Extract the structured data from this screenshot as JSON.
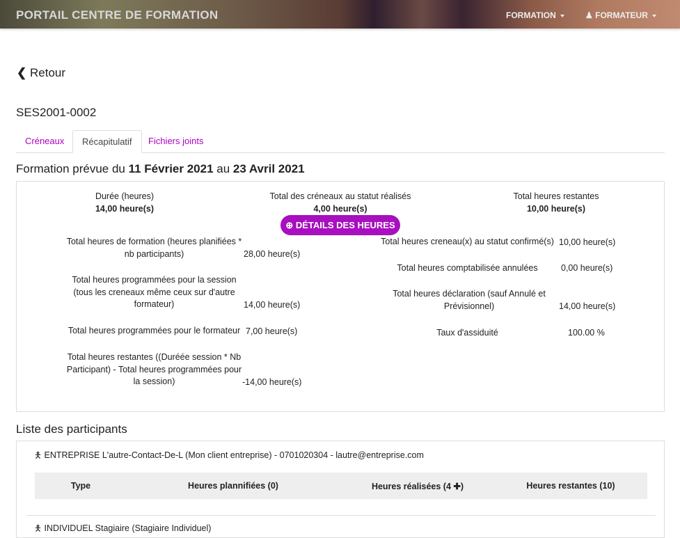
{
  "nav": {
    "brand": "PORTAIL CENTRE DE FORMATION",
    "formation": "FORMATION",
    "formateur": "FORMATEUR"
  },
  "back": "Retour",
  "session_id": "SES2001-0002",
  "tabs": [
    "Créneaux",
    "Récapitulatif",
    "Fichiers joints"
  ],
  "heading": {
    "prefix": "Formation prévue du ",
    "start": "11 Février 2021",
    "mid": " au ",
    "end": "23 Avril 2021"
  },
  "summary": [
    {
      "label": "Durée (heures)",
      "value": "14,00 heure(s)"
    },
    {
      "label": "Total des créneaux au statut réalisés",
      "value": "4,00 heure(s)"
    },
    {
      "label": "Total heures restantes",
      "value": "10,00 heure(s)"
    }
  ],
  "details_button": "DÉTAILS DES HEURES",
  "left_details": [
    {
      "label": "Total heures de formation (heures planifiées * nb participants)",
      "value": "28,00 heure(s)"
    },
    {
      "label": "Total heures programmées pour la session (tous les creneaux même ceux sur d'autre formateur)",
      "value": "14,00 heure(s)"
    },
    {
      "label": "Total heures programmées pour le formateur",
      "value": "7,00 heure(s)"
    },
    {
      "label": "Total heures restantes ((Duréée session * Nb Participant) - Total heures programmées pour la session)",
      "value": "-14,00 heure(s)"
    }
  ],
  "right_details": [
    {
      "label": "Total heures creneau(x) au statut confirmé(s)",
      "value": "10,00 heure(s)"
    },
    {
      "label": "Total heures comptabilisée annulées",
      "value": "0,00 heure(s)"
    },
    {
      "label": "Total heures déclaration (sauf Annulé et Prévisionnel)",
      "value": "14,00 heure(s)"
    },
    {
      "label": "Taux d'assiduité",
      "value": "100.00 %"
    }
  ],
  "participants_title": "Liste des participants",
  "participants": [
    {
      "name": "ENTREPRISE L'autre-Contact-De-L (Mon client entreprise) - 0701020304 - lautre@entreprise.com",
      "columns": [
        "Type",
        "Heures plannifiées (0)",
        "Heures réalisées (4",
        "Heures restantes (10)"
      ]
    },
    {
      "name": "INDIVIDUEL Stagiaire (Stagiaire Individuel)"
    }
  ]
}
